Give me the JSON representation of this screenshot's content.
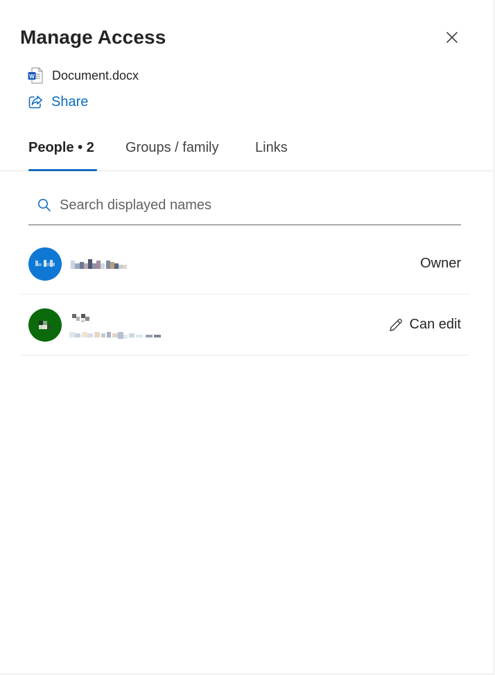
{
  "panel": {
    "title": "Manage Access",
    "close_label": "Close"
  },
  "file": {
    "name": "Document.docx",
    "icon": "word-doc-icon"
  },
  "share": {
    "label": "Share",
    "icon": "share-icon"
  },
  "tabs": [
    {
      "label": "People • 2",
      "active": true
    },
    {
      "label": "Groups / family",
      "active": false
    },
    {
      "label": "Links",
      "active": false
    }
  ],
  "search": {
    "placeholder": "Search displayed names",
    "value": "",
    "icon": "search-icon"
  },
  "people": [
    {
      "name_redacted": true,
      "avatar_color": "#0f78d4",
      "role": "Owner"
    },
    {
      "name_redacted": true,
      "email_redacted": true,
      "avatar_color": "#0b6a0b",
      "role": "Can edit",
      "role_icon": "pencil-icon"
    }
  ],
  "colors": {
    "accent": "#0f6cbd",
    "text": "#242424"
  }
}
